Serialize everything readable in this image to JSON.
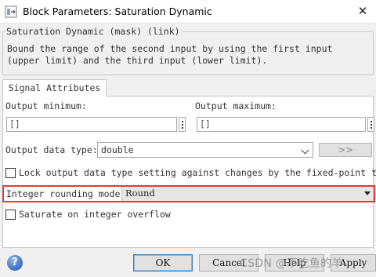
{
  "window": {
    "title": "Block Parameters: Saturation Dynamic",
    "close_glyph": "✕"
  },
  "mask": {
    "legend": "Saturation Dynamic (mask) (link)",
    "description": "Bound the range of the second input by using the first input (upper limit) and the third input (lower limit)."
  },
  "tabs": [
    {
      "label": "Signal Attributes",
      "selected": true
    }
  ],
  "fields": {
    "output_minimum": {
      "label": "Output minimum:",
      "value": "[]"
    },
    "output_maximum": {
      "label": "Output maximum:",
      "value": "[]"
    },
    "output_data_type": {
      "label": "Output data type:",
      "value": "double"
    },
    "assistant_button_label": ">>"
  },
  "checkboxes": {
    "lock_output": {
      "label": "Lock output data type setting against changes by the fixed-point t⋯",
      "checked": false
    },
    "saturate_overflow": {
      "label": "Saturate on integer overflow",
      "checked": false
    }
  },
  "rounding": {
    "label": "Integer rounding mode:",
    "value": "Round",
    "highlight_color": "#e53935"
  },
  "buttons": {
    "ok": "OK",
    "cancel": "Cancel",
    "help": "Help",
    "apply": "Apply"
  },
  "help_icon_glyph": "?",
  "watermark": "CSDN @不吃鱼的羊"
}
